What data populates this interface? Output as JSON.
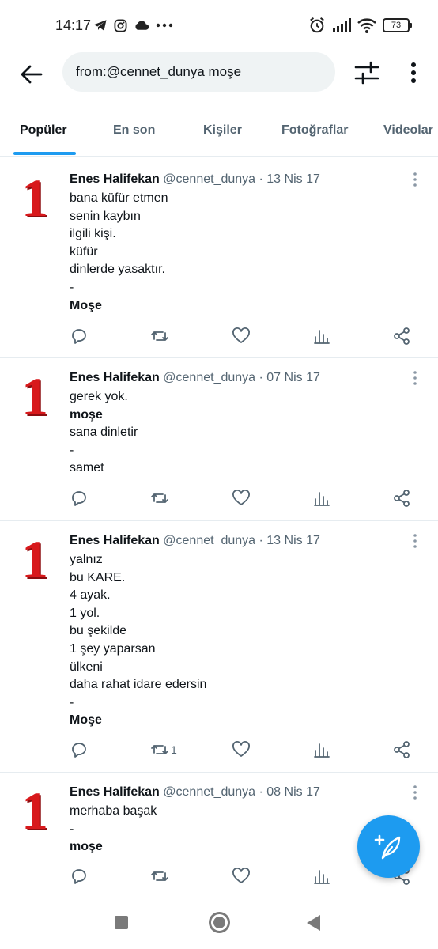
{
  "status_bar": {
    "time": "14:17",
    "battery": "73",
    "left_icons": [
      "telegram-icon",
      "instagram-icon",
      "cloud-icon",
      "more-dots-icon"
    ],
    "right_icons": [
      "alarm-icon",
      "signal-icon",
      "wifi-icon",
      "battery-icon"
    ]
  },
  "header": {
    "search_value": "from:@cennet_dunya moşe"
  },
  "tabs": [
    {
      "label": "Popüler",
      "active": true
    },
    {
      "label": "En son",
      "active": false
    },
    {
      "label": "Kişiler",
      "active": false
    },
    {
      "label": "Fotoğraflar",
      "active": false
    },
    {
      "label": "Videolar",
      "active": false
    }
  ],
  "tweets": [
    {
      "name": "Enes Halifekan",
      "meta": "@cennet_dunya · 13 Nis 17",
      "avatar_text": "1",
      "lines": [
        {
          "text": "bana küfür etmen",
          "bold": false
        },
        {
          "text": "senin kaybın",
          "bold": false
        },
        {
          "text": "ilgili kişi.",
          "bold": false
        },
        {
          "text": "küfür",
          "bold": false
        },
        {
          "text": "dinlerde yasaktır.",
          "bold": false
        },
        {
          "text": "-",
          "bold": false
        },
        {
          "text": "Moşe",
          "bold": true
        }
      ],
      "retweet_count": ""
    },
    {
      "name": "Enes Halifekan",
      "meta": "@cennet_dunya · 07 Nis 17",
      "avatar_text": "1",
      "lines": [
        {
          "text": "gerek yok.",
          "bold": false
        },
        {
          "text": "moşe",
          "bold": true
        },
        {
          "text": "sana dinletir",
          "bold": false
        },
        {
          "text": "-",
          "bold": false
        },
        {
          "text": "samet",
          "bold": false
        }
      ],
      "retweet_count": ""
    },
    {
      "name": "Enes Halifekan",
      "meta": "@cennet_dunya · 13 Nis 17",
      "avatar_text": "1",
      "lines": [
        {
          "text": "yalnız",
          "bold": false
        },
        {
          "text": "bu KARE.",
          "bold": false
        },
        {
          "text": "4 ayak.",
          "bold": false
        },
        {
          "text": "1 yol.",
          "bold": false
        },
        {
          "text": "bu şekilde",
          "bold": false
        },
        {
          "text": "1 şey yaparsan",
          "bold": false
        },
        {
          "text": "ülkeni",
          "bold": false
        },
        {
          "text": "daha rahat idare edersin",
          "bold": false
        },
        {
          "text": "-",
          "bold": false
        },
        {
          "text": "Moşe",
          "bold": true
        }
      ],
      "retweet_count": "1"
    },
    {
      "name": "Enes Halifekan",
      "meta": "@cennet_dunya · 08 Nis 17",
      "avatar_text": "1",
      "lines": [
        {
          "text": "merhaba başak",
          "bold": false
        },
        {
          "text": "-",
          "bold": false
        },
        {
          "text": "moşe",
          "bold": true
        }
      ],
      "retweet_count": ""
    }
  ],
  "colors": {
    "accent": "#1d9bf0",
    "text_primary": "#0f1419",
    "text_secondary": "#536471",
    "avatar_red": "#d8191c"
  }
}
